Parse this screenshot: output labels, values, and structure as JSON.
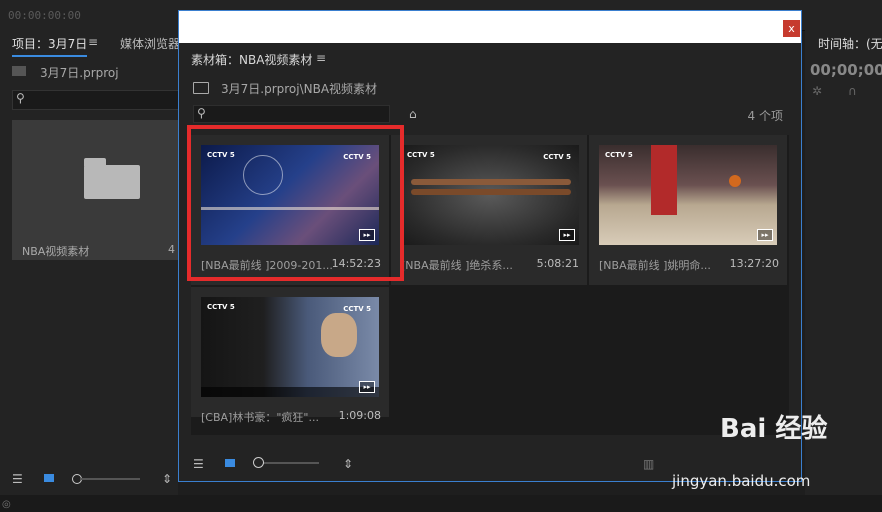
{
  "app": {
    "timecode": "00:00:00:00",
    "tabs": [
      "项目：3月7日",
      "媒体浏览器"
    ],
    "project_file": "3月7日.prproj",
    "bin_name": "NBA视频素材",
    "bin_count": "4",
    "right_tab": "时间轴：(无",
    "right_timecode": "00;00;00;"
  },
  "modal": {
    "close_label": "x",
    "title": "素材箱：NBA视频素材",
    "menu_label": "≡",
    "path": "3月7日.prproj\\NBA视频素材",
    "search_placeholder": "",
    "item_count": "4 个项",
    "items": [
      {
        "name": "[NBA最前线 ]2009-201...",
        "duration": "14:52:23"
      },
      {
        "name": "[NBA最前线 ]绝杀系...",
        "duration": "5:08:21"
      },
      {
        "name": "[NBA最前线 ]姚明命...",
        "duration": "13:27:20"
      },
      {
        "name": "[CBA]林书豪：\"疯狂\"...",
        "duration": "1:09:08"
      }
    ],
    "thumb_label": "CCTV 5"
  },
  "watermark": {
    "brand": "Bai 经验",
    "url": "jingyan.baidu.com"
  },
  "colors": {
    "accent": "#3a8be0",
    "highlight": "#e52b2b",
    "close": "#c63a2e"
  }
}
